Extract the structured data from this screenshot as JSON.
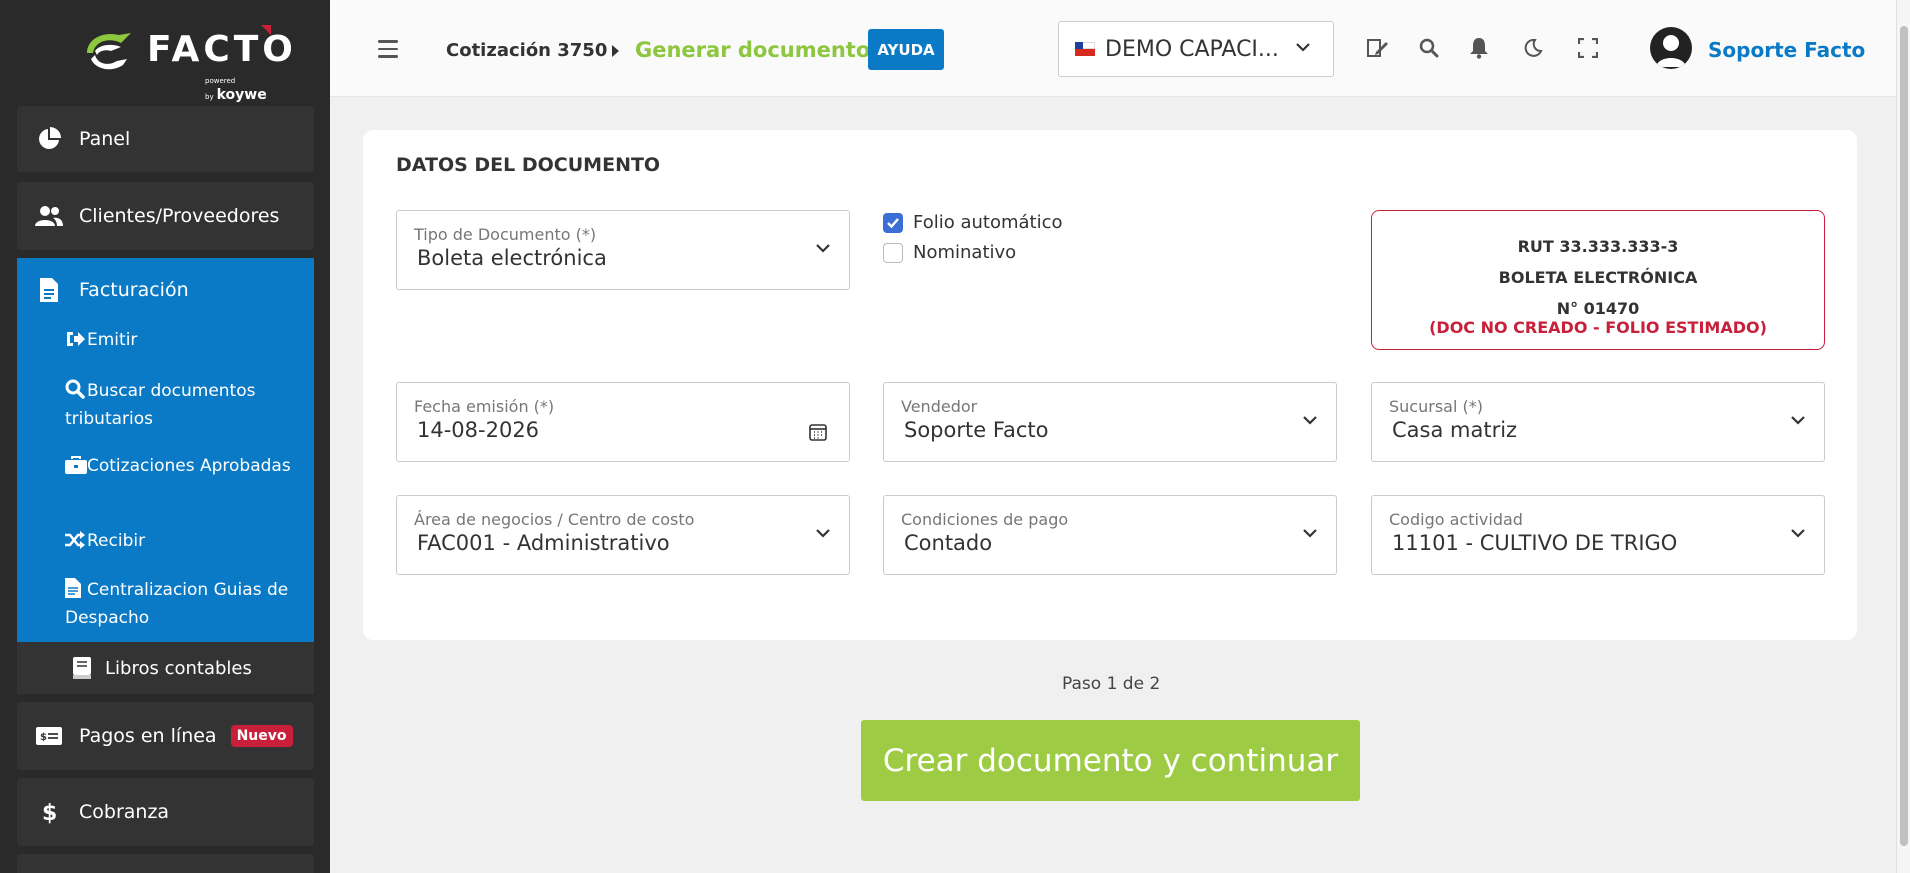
{
  "sidebar": {
    "logo_text": "FACTO",
    "logo_powered": "powered by",
    "logo_brand": "koywe",
    "panel": "Panel",
    "clientes": "Clientes/Proveedores",
    "facturacion": "Facturación",
    "sub": {
      "emitir": "Emitir",
      "buscar": "Buscar documentos tributarios",
      "cotizaciones": "Cotizaciones Aprobadas",
      "recibir": "Recibir",
      "centralizacion": "Centralizacion Guias de Despacho"
    },
    "libros": "Libros contables",
    "pagos": "Pagos en línea",
    "pagos_badge": "Nuevo",
    "cobranza": "Cobranza"
  },
  "header": {
    "breadcrumb_parent": "Cotización 3750",
    "breadcrumb_current": "Generar documento",
    "help_label": "AYUDA",
    "company": "DEMO CAPACI...",
    "user": "Soporte Facto"
  },
  "form": {
    "title": "DATOS DEL DOCUMENTO",
    "tipo": {
      "label": "Tipo de Documento (*)",
      "value": "Boleta electrónica"
    },
    "folio_auto": {
      "label": "Folio automático",
      "checked": true
    },
    "nominativo": {
      "label": "Nominativo",
      "checked": false
    },
    "rut_box": {
      "rut": "RUT 33.333.333-3",
      "doc": "BOLETA ELECTRÓNICA",
      "num": "N° 01470",
      "warning": "(DOC NO CREADO - FOLIO ESTIMADO)"
    },
    "fecha": {
      "label": "Fecha emisión (*)",
      "value": "14-08-2026"
    },
    "vendedor": {
      "label": "Vendedor",
      "value": "Soporte Facto"
    },
    "sucursal": {
      "label": "Sucursal (*)",
      "value": "Casa matriz"
    },
    "area": {
      "label": "Área de negocios / Centro de costo",
      "value": "FAC001 - Administrativo"
    },
    "condiciones": {
      "label": "Condiciones de pago",
      "value": "Contado"
    },
    "codigo": {
      "label": "Codigo actividad",
      "value": "11101 - CULTIVO DE TRIGO"
    }
  },
  "footer": {
    "step": "Paso 1 de 2",
    "submit": "Crear documento y continuar"
  },
  "colors": {
    "primary_blue": "#0b7ac6",
    "accent_green": "#8dc63f",
    "button_green": "#9dcc44",
    "danger_red": "#c8203a",
    "sidebar_bg": "#2a2a2a"
  }
}
